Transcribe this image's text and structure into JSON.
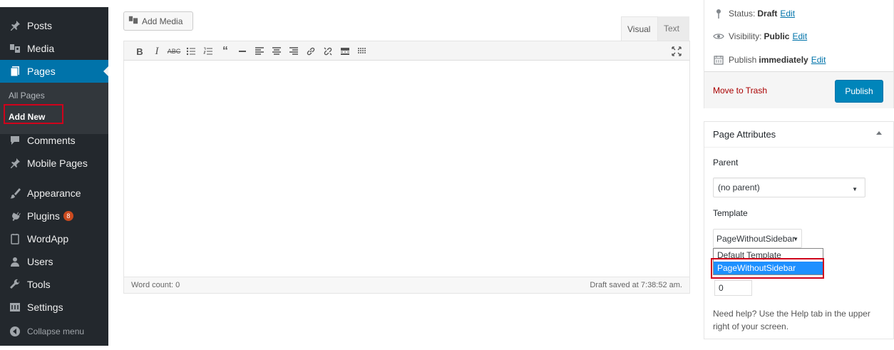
{
  "sidebar": {
    "items": [
      {
        "label": "Posts",
        "icon": "pushpin-icon"
      },
      {
        "label": "Media",
        "icon": "media-icon"
      },
      {
        "label": "Pages",
        "icon": "pages-icon"
      },
      {
        "label": "Comments",
        "icon": "comment-icon"
      },
      {
        "label": "Mobile Pages",
        "icon": "pushpin-icon"
      },
      {
        "label": "Appearance",
        "icon": "brush-icon"
      },
      {
        "label": "Plugins",
        "icon": "plugin-icon",
        "badge": "8"
      },
      {
        "label": "WordApp",
        "icon": "phone-icon"
      },
      {
        "label": "Users",
        "icon": "user-icon"
      },
      {
        "label": "Tools",
        "icon": "wrench-icon"
      },
      {
        "label": "Settings",
        "icon": "settings-icon"
      },
      {
        "label": "Collapse menu",
        "icon": "collapse-icon"
      }
    ],
    "submenu": {
      "all_pages": "All Pages",
      "add_new": "Add New"
    }
  },
  "editor": {
    "add_media": "Add Media",
    "tab_visual": "Visual",
    "tab_text": "Text",
    "toolbar": [
      "bold",
      "italic",
      "strikethrough",
      "bullet-list",
      "numbered-list",
      "blockquote",
      "horizontal-line",
      "align-left",
      "align-center",
      "align-right",
      "insert-link",
      "remove-link",
      "read-more",
      "toolbar-toggle"
    ],
    "word_count": "Word count: 0",
    "draft_saved": "Draft saved at 7:38:52 am."
  },
  "publish": {
    "status_label": "Status:",
    "status_value": "Draft",
    "visibility_label": "Visibility:",
    "visibility_value": "Public",
    "publish_label": "Publish",
    "publish_value": "immediately",
    "edit": "Edit",
    "move_to_trash": "Move to Trash",
    "publish_button": "Publish"
  },
  "page_attributes": {
    "title": "Page Attributes",
    "parent_label": "Parent",
    "parent_value": "(no parent)",
    "template_label": "Template",
    "template_value": "PageWithoutSidebar",
    "template_options": [
      "Default Template",
      "PageWithoutSidebar"
    ],
    "order_value": "0",
    "help_text": "Need help? Use the Help tab in the upper right of your screen."
  },
  "colors": {
    "sidebar_bg": "#23282d",
    "active_blue": "#0073aa",
    "publish_blue": "#0085ba",
    "highlight_red": "#d0021b",
    "trash_red": "#aa0000"
  }
}
